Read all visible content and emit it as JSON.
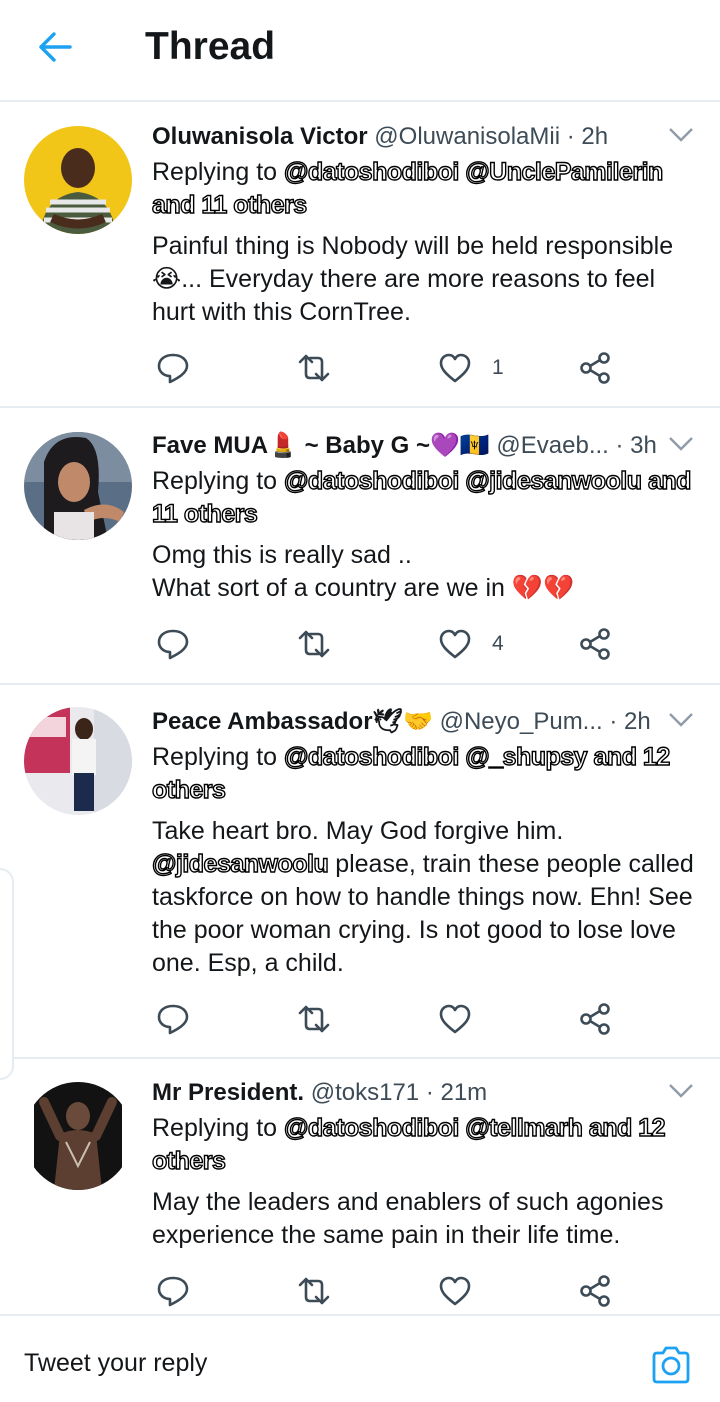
{
  "header": {
    "title": "Thread",
    "back_icon": "arrow-left-icon",
    "accent": "#1da1f2"
  },
  "tweets": [
    {
      "name": "Oluwanisola Victor",
      "handle": "@OluwanisolaMii",
      "time": "2h",
      "replying_prefix": "Replying to",
      "replying_targets": "@datoshodiboi @UnclePamilerin and 11 others",
      "text": "Painful thing is Nobody will be held responsible 😭... Everyday there are more reasons to feel hurt with this CornTree.",
      "likes": "1"
    },
    {
      "name": "Fave MUA💄 ~ Baby G ~💜🇧🇧",
      "handle": "@Evaeb...",
      "time": "3h",
      "replying_prefix": "Replying to",
      "replying_targets": "@datoshodiboi @jidesanwoolu and 11 others",
      "text": "Omg this is really sad ..\nWhat sort of a country are we in 💔💔",
      "likes": "4"
    },
    {
      "name": "Peace Ambassador🕊🤝",
      "handle": "@Neyo_Pum...",
      "time": "2h",
      "replying_prefix": "Replying to",
      "replying_targets": "@datoshodiboi @_shupsy and 12 others",
      "text_mention": "@jidesanwoolu",
      "text_part1": "Take heart bro. May God forgive him.",
      "text_part2": "please, train these people called taskforce on how to handle things now. Ehn! See the poor woman crying. Is not good to lose love one. Esp, a child.",
      "likes": ""
    },
    {
      "name": "Mr President.",
      "handle": "@toks171",
      "time": "21m",
      "replying_prefix": "Replying to",
      "replying_targets": "@datoshodiboi @tellmarh and 12 others",
      "text": "May the leaders and enablers of such  agonies experience the same pain in their life time.",
      "likes": ""
    }
  ],
  "composer": {
    "placeholder": "Tweet your reply",
    "camera_icon": "camera-icon"
  },
  "icons": {
    "reply": "reply-icon",
    "retweet": "retweet-icon",
    "like": "heart-icon",
    "share": "share-icon",
    "more": "chevron-down-icon"
  },
  "colors": {
    "icon_gray": "#3d4b57",
    "divider": "#e6ecf0",
    "accent": "#1da1f2"
  }
}
